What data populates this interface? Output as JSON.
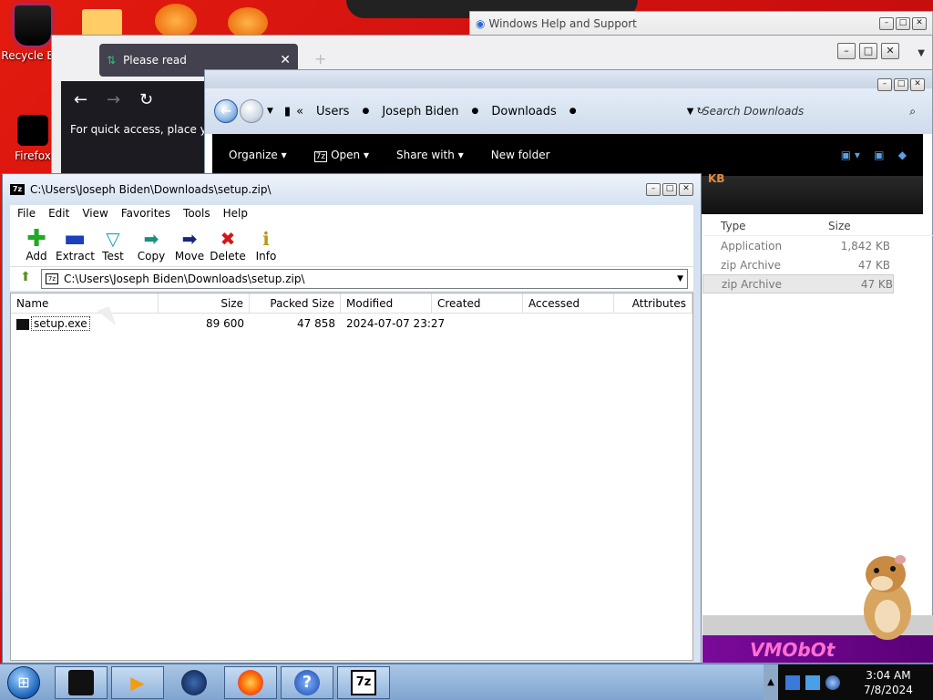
{
  "desktop": {
    "icons": [
      {
        "label": "Recycle Bin"
      },
      {
        "label": "Firefox"
      }
    ]
  },
  "help_window": {
    "title": "Windows Help and Support"
  },
  "firefox": {
    "tab_title": "Please read",
    "quick_access_text": "For quick access, place your"
  },
  "explorer": {
    "breadcrumbs": [
      "Users",
      "Joseph Biden",
      "Downloads"
    ],
    "search_placeholder": "Search Downloads",
    "toolbar": {
      "organize": "Organize",
      "open": "Open",
      "share_with": "Share with",
      "new_folder": "New folder"
    },
    "partial_size_header": "KB",
    "columns": {
      "type": "Type",
      "size": "Size"
    },
    "rows": [
      {
        "type": "Application",
        "size": "1,842 KB"
      },
      {
        "type": "zip Archive",
        "size": "47 KB"
      },
      {
        "type": "zip Archive",
        "size": "47 KB"
      }
    ],
    "banner_text": "VMObOt"
  },
  "sevenzip": {
    "title": "C:\\Users\\Joseph Biden\\Downloads\\setup.zip\\",
    "app_icon_text": "7z",
    "menu": [
      "File",
      "Edit",
      "View",
      "Favorites",
      "Tools",
      "Help"
    ],
    "tools": [
      {
        "label": "Add",
        "icon": "plus-icon",
        "color": "#22aa22"
      },
      {
        "label": "Extract",
        "icon": "minus-icon",
        "color": "#1a3fbf"
      },
      {
        "label": "Test",
        "icon": "check-icon",
        "color": "#1aa6b8"
      },
      {
        "label": "Copy",
        "icon": "copy-arrow-icon",
        "color": "#1b8f7f"
      },
      {
        "label": "Move",
        "icon": "move-arrow-icon",
        "color": "#1a237e"
      },
      {
        "label": "Delete",
        "icon": "delete-x-icon",
        "color": "#d01818"
      },
      {
        "label": "Info",
        "icon": "info-icon",
        "color": "#b89a10"
      }
    ],
    "path": "C:\\Users\\Joseph Biden\\Downloads\\setup.zip\\",
    "columns": {
      "name": "Name",
      "size": "Size",
      "packed": "Packed Size",
      "modified": "Modified",
      "created": "Created",
      "accessed": "Accessed",
      "attributes": "Attributes"
    },
    "files": [
      {
        "name": "setup.exe",
        "size": "89 600",
        "packed": "47 858",
        "modified": "2024-07-07 23:27"
      }
    ]
  },
  "taskbar": {
    "clock_time": "3:04 AM",
    "clock_date": "7/8/2024",
    "seven_zip_label": "7z"
  }
}
